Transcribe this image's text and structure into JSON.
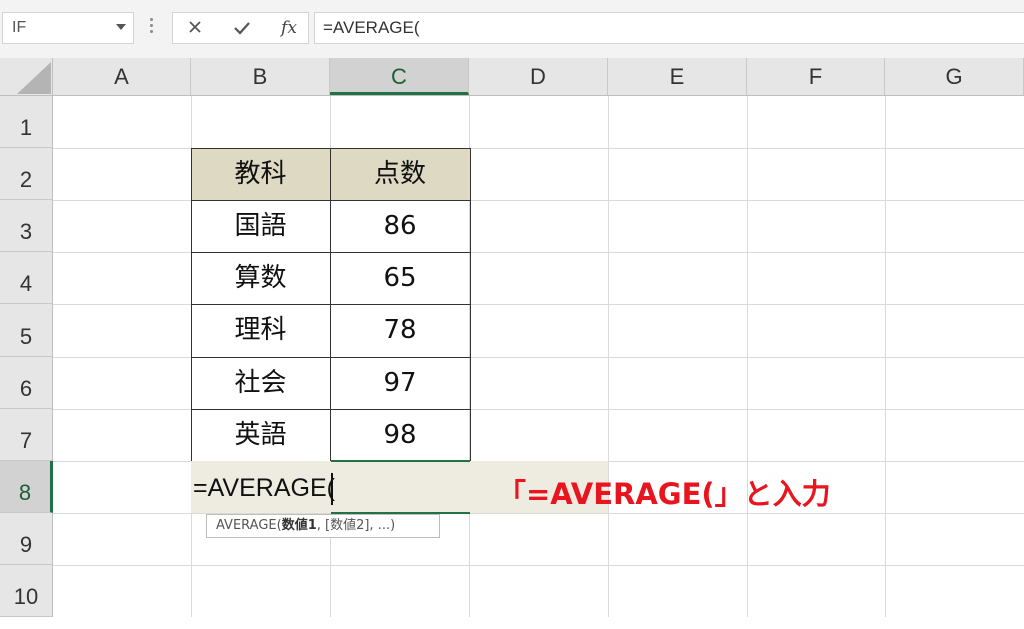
{
  "formula_bar": {
    "name_box": "IF",
    "formula": "=AVERAGE(",
    "fx_label": "fx"
  },
  "columns": [
    "A",
    "B",
    "C",
    "D",
    "E",
    "F",
    "G"
  ],
  "rows": [
    "1",
    "2",
    "3",
    "4",
    "5",
    "6",
    "7",
    "8",
    "9",
    "10"
  ],
  "selected_column": "C",
  "selected_row": "8",
  "table": {
    "headers": [
      "教科",
      "点数"
    ],
    "rows": [
      {
        "subject": "国語",
        "score": "86"
      },
      {
        "subject": "算数",
        "score": "65"
      },
      {
        "subject": "理科",
        "score": "78"
      },
      {
        "subject": "社会",
        "score": "97"
      },
      {
        "subject": "英語",
        "score": "98"
      }
    ]
  },
  "editing_cell_text": "=AVERAGE(",
  "tooltip": {
    "func": "AVERAGE(",
    "arg1": "数値1",
    "rest": ", [数値2], ...)"
  },
  "annotation": "「=AVERAGE(」と入力",
  "colors": {
    "header_fill": "#ddd9c3",
    "selection_green": "#217346",
    "annotation_red": "#e8141e"
  }
}
